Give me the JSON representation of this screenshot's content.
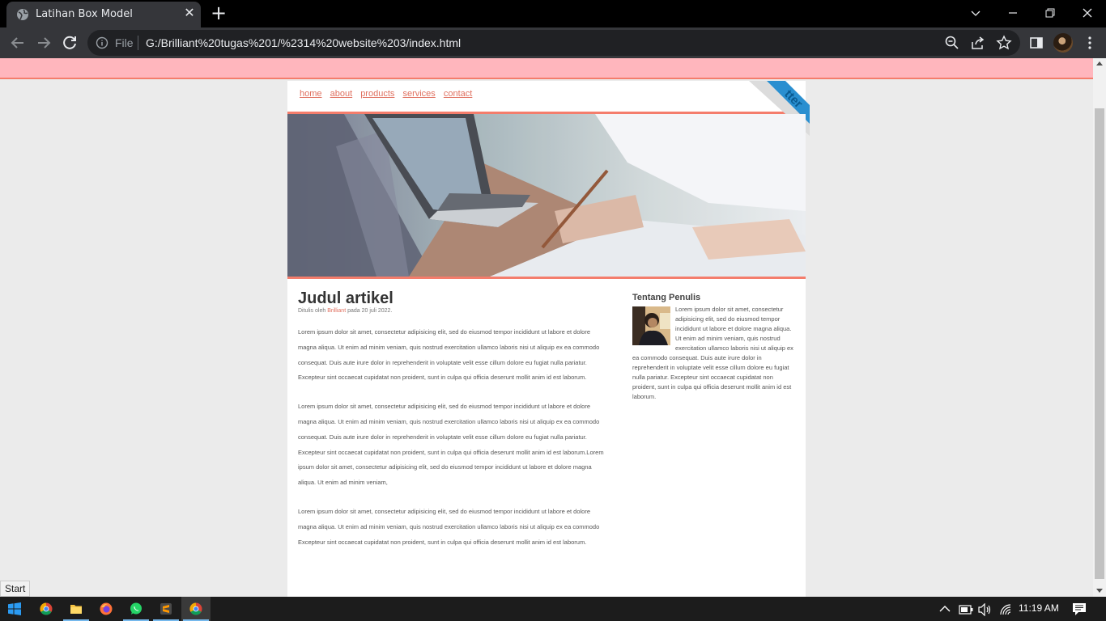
{
  "browser": {
    "tab_title": "Latihan Box Model",
    "tab_close": "✕",
    "new_tab": "+",
    "url_scheme": "File",
    "url": "G:/Brilliant%20tugas%201/%2314%20website%203/index.html"
  },
  "site": {
    "nav": [
      "home",
      "about",
      "products",
      "services",
      "contact"
    ],
    "ribbon_text": "tter",
    "article": {
      "title": "Judul artikel",
      "byline_prefix": "Ditulis oleh ",
      "byline_author": "Brilliant",
      "byline_suffix": " pada 20 juli 2022.",
      "paragraphs": [
        "Lorem ipsum dolor sit amet, consectetur adipisicing elit, sed do eiusmod tempor incididunt ut labore et dolore magna aliqua. Ut enim ad minim veniam, quis nostrud exercitation ullamco laboris nisi ut aliquip ex ea commodo consequat. Duis aute irure dolor in reprehenderit in voluptate velit esse cillum dolore eu fugiat nulla pariatur. Excepteur sint occaecat cupidatat non proident, sunt in culpa qui officia deserunt mollit anim id est laborum.",
        "Lorem ipsum dolor sit amet, consectetur adipisicing elit, sed do eiusmod tempor incididunt ut labore et dolore magna aliqua. Ut enim ad minim veniam, quis nostrud exercitation ullamco laboris nisi ut aliquip ex ea commodo consequat. Duis aute irure dolor in reprehenderit in voluptate velit esse cillum dolore eu fugiat nulla pariatur. Excepteur sint occaecat cupidatat non proident, sunt in culpa qui officia deserunt mollit anim id est laborum.Lorem ipsum dolor sit amet, consectetur adipisicing elit, sed do eiusmod tempor incididunt ut labore et dolore magna aliqua. Ut enim ad minim veniam,",
        "Lorem ipsum dolor sit amet, consectetur adipisicing elit, sed do eiusmod tempor incididunt ut labore et dolore magna aliqua. Ut enim ad minim veniam, quis nostrud exercitation ullamco laboris nisi ut aliquip ex ea commodo Excepteur sint occaecat cupidatat non proident, sunt in culpa qui officia deserunt mollit anim id est laborum."
      ]
    },
    "sidebar": {
      "title": "Tentang Penulis",
      "body": "Lorem ipsum dolor sit amet, consectetur adipisicing elit, sed do eiusmod tempor incididunt ut labore et dolore magna aliqua. Ut enim ad minim veniam, quis nostrud exercitation ullamco laboris nisi ut aliquip ex ea commodo consequat. Duis aute irure dolor in reprehenderit in voluptate velit esse cillum dolore eu fugiat nulla pariatur. Excepteur sint occaecat cupidatat non proident, sunt in culpa qui officia deserunt mollit anim id est laborum."
    }
  },
  "status_text": "Start",
  "taskbar": {
    "clock": "11:19 AM"
  },
  "colors": {
    "accent": "#f47d6c",
    "band": "#ffb6bd",
    "link": "#e0705f"
  }
}
